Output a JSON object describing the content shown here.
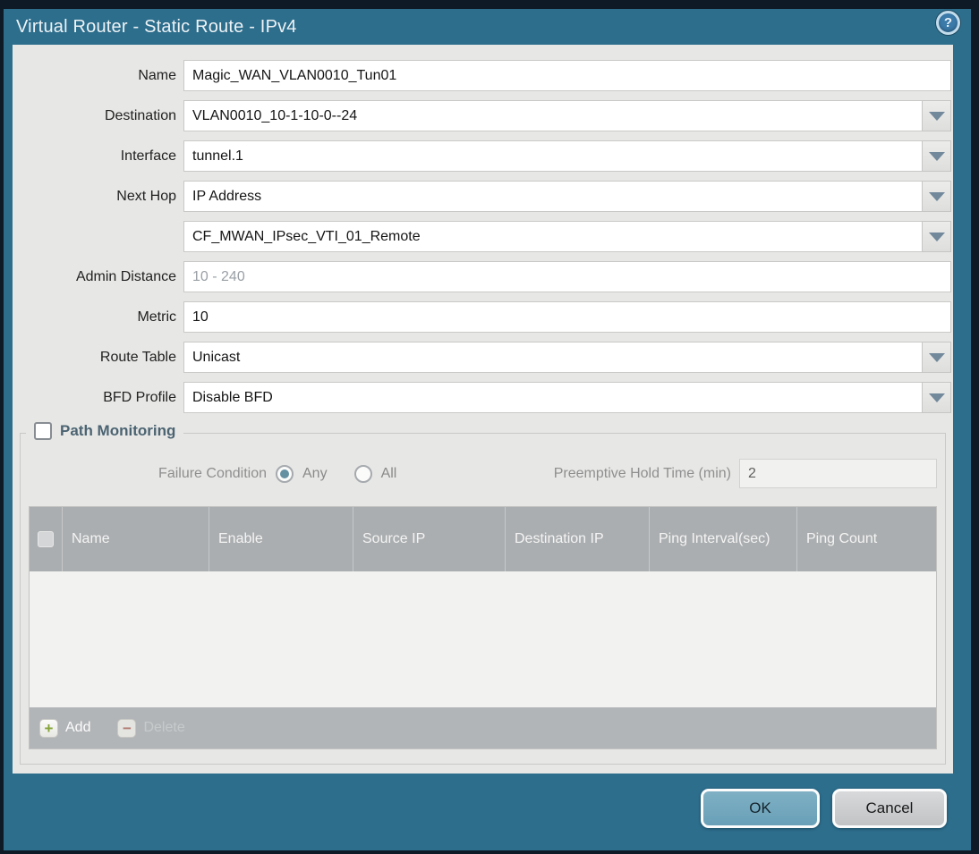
{
  "titlebar": {
    "title": "Virtual Router - Static Route - IPv4",
    "help_glyph": "?"
  },
  "form": {
    "rows": [
      {
        "label": "Name",
        "value": "Magic_WAN_VLAN0010_Tun01"
      },
      {
        "label": "Destination",
        "value": "VLAN0010_10-1-10-0--24"
      },
      {
        "label": "Interface",
        "value": "tunnel.1"
      },
      {
        "label": "Next Hop",
        "value": "IP Address"
      },
      {
        "label": "",
        "value": "CF_MWAN_IPsec_VTI_01_Remote"
      },
      {
        "label": "Admin Distance",
        "value": "",
        "placeholder": "10 - 240"
      },
      {
        "label": "Metric",
        "value": "10"
      },
      {
        "label": "Route Table",
        "value": "Unicast"
      },
      {
        "label": "BFD Profile",
        "value": "Disable BFD"
      }
    ]
  },
  "path_monitoring": {
    "legend": "Path Monitoring",
    "checkbox_checked": false,
    "failure_condition": {
      "label": "Failure Condition",
      "options": [
        {
          "label": "Any",
          "selected": true
        },
        {
          "label": "All",
          "selected": false
        }
      ]
    },
    "preemptive_hold_time": {
      "label": "Preemptive Hold Time (min)",
      "value": "2"
    },
    "table": {
      "columns": [
        {
          "label": "Name"
        },
        {
          "label": "Enable"
        },
        {
          "label": "Source IP"
        },
        {
          "label": "Destination IP"
        },
        {
          "label": "Ping Interval(sec)"
        },
        {
          "label": "Ping Count"
        }
      ],
      "rows": [],
      "add_label": "Add",
      "delete_label": "Delete",
      "delete_enabled": false
    }
  },
  "footer": {
    "ok_label": "OK",
    "cancel_label": "Cancel"
  },
  "colors": {
    "frame_teal": "#2d6e8d",
    "outer_border": "#0e1a25",
    "content_bg": "#e7e7e5",
    "table_header_gray": "#abaeb0",
    "ok_button": "#74a7bd",
    "radio_selected": "#6590a2",
    "add_plus_green": "#84a437",
    "delete_minus_red": "#b17a70"
  }
}
